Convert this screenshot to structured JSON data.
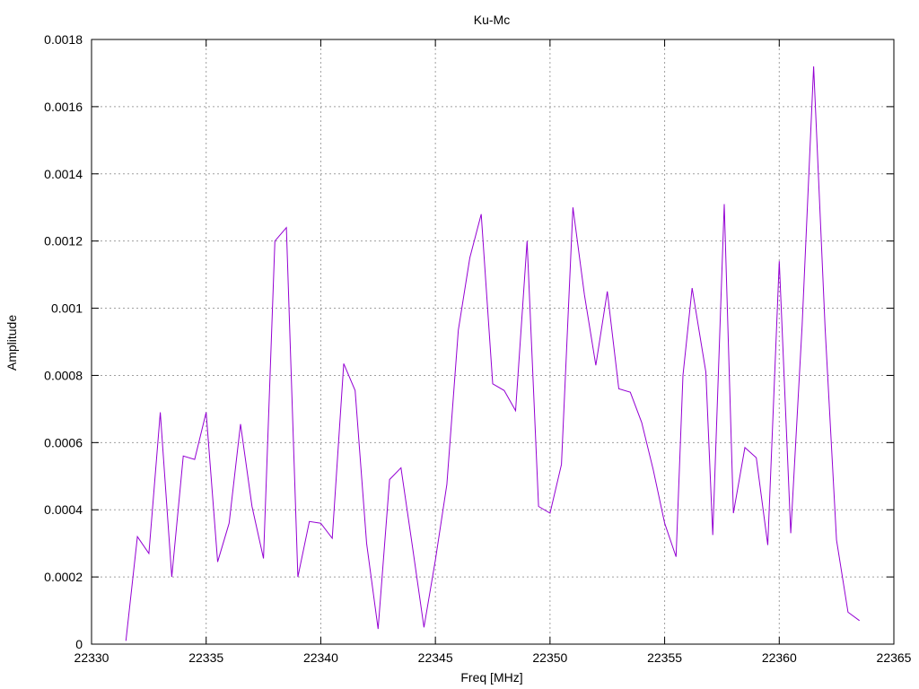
{
  "chart_data": {
    "type": "line",
    "title": "Ku-Mc",
    "xlabel": "Freq [MHz]",
    "ylabel": "Amplitude",
    "xlim": [
      22330,
      22365
    ],
    "ylim": [
      0,
      0.0018
    ],
    "x_ticks": [
      22330,
      22335,
      22340,
      22345,
      22350,
      22355,
      22360,
      22365
    ],
    "x_tick_labels": [
      "22330",
      "22335",
      "22340",
      "22345",
      "22350",
      "22355",
      "22360",
      "22365"
    ],
    "y_ticks": [
      0,
      0.0002,
      0.0004,
      0.0006,
      0.0008,
      0.001,
      0.0012,
      0.0014,
      0.0016,
      0.0018
    ],
    "y_tick_labels": [
      "0",
      "0.0002",
      "0.0004",
      "0.0006",
      "0.0008",
      "0.001",
      "0.0012",
      "0.0014",
      "0.0016",
      "0.0018"
    ],
    "grid": true,
    "series": [
      {
        "color": "#9400d3",
        "points": [
          [
            22331.5,
            1e-05
          ],
          [
            22332.0,
            0.00032
          ],
          [
            22332.5,
            0.00027
          ],
          [
            22333.0,
            0.00069
          ],
          [
            22333.5,
            0.0002
          ],
          [
            22334.0,
            0.00056
          ],
          [
            22334.5,
            0.00055
          ],
          [
            22335.0,
            0.00069
          ],
          [
            22335.5,
            0.000245
          ],
          [
            22336.0,
            0.00036
          ],
          [
            22336.5,
            0.000655
          ],
          [
            22337.0,
            0.00041
          ],
          [
            22337.5,
            0.000255
          ],
          [
            22338.0,
            0.0012
          ],
          [
            22338.5,
            0.00124
          ],
          [
            22339.0,
            0.0002
          ],
          [
            22339.5,
            0.000365
          ],
          [
            22340.0,
            0.00036
          ],
          [
            22340.5,
            0.000315
          ],
          [
            22341.0,
            0.000835
          ],
          [
            22341.5,
            0.000755
          ],
          [
            22342.0,
            0.0003
          ],
          [
            22342.5,
            4.5e-05
          ],
          [
            22343.0,
            0.00049
          ],
          [
            22343.5,
            0.000525
          ],
          [
            22344.0,
            0.00029
          ],
          [
            22344.5,
            5e-05
          ],
          [
            22345.0,
            0.00025
          ],
          [
            22345.5,
            0.000475
          ],
          [
            22346.0,
            0.000935
          ],
          [
            22346.5,
            0.00115
          ],
          [
            22347.0,
            0.00128
          ],
          [
            22347.5,
            0.000775
          ],
          [
            22348.0,
            0.000755
          ],
          [
            22348.5,
            0.000695
          ],
          [
            22349.0,
            0.0012
          ],
          [
            22349.5,
            0.00041
          ],
          [
            22350.0,
            0.00039
          ],
          [
            22350.5,
            0.000535
          ],
          [
            22351.0,
            0.0013
          ],
          [
            22351.5,
            0.00104
          ],
          [
            22352.0,
            0.00083
          ],
          [
            22352.5,
            0.00105
          ],
          [
            22353.0,
            0.00076
          ],
          [
            22353.5,
            0.00075
          ],
          [
            22354.0,
            0.00066
          ],
          [
            22354.5,
            0.00052
          ],
          [
            22355.0,
            0.00036
          ],
          [
            22355.5,
            0.00026
          ],
          [
            22355.8,
            0.0008
          ],
          [
            22356.2,
            0.00106
          ],
          [
            22356.8,
            0.00081
          ],
          [
            22357.1,
            0.000325
          ],
          [
            22357.6,
            0.00131
          ],
          [
            22358.0,
            0.00039
          ],
          [
            22358.5,
            0.000585
          ],
          [
            22359.0,
            0.000555
          ],
          [
            22359.5,
            0.000295
          ],
          [
            22360.0,
            0.00114
          ],
          [
            22360.5,
            0.00033
          ],
          [
            22361.0,
            0.00095
          ],
          [
            22361.5,
            0.00172
          ],
          [
            22362.0,
            0.00094
          ],
          [
            22362.5,
            0.00031
          ],
          [
            22363.0,
            9.5e-05
          ],
          [
            22363.5,
            7e-05
          ]
        ]
      }
    ]
  }
}
